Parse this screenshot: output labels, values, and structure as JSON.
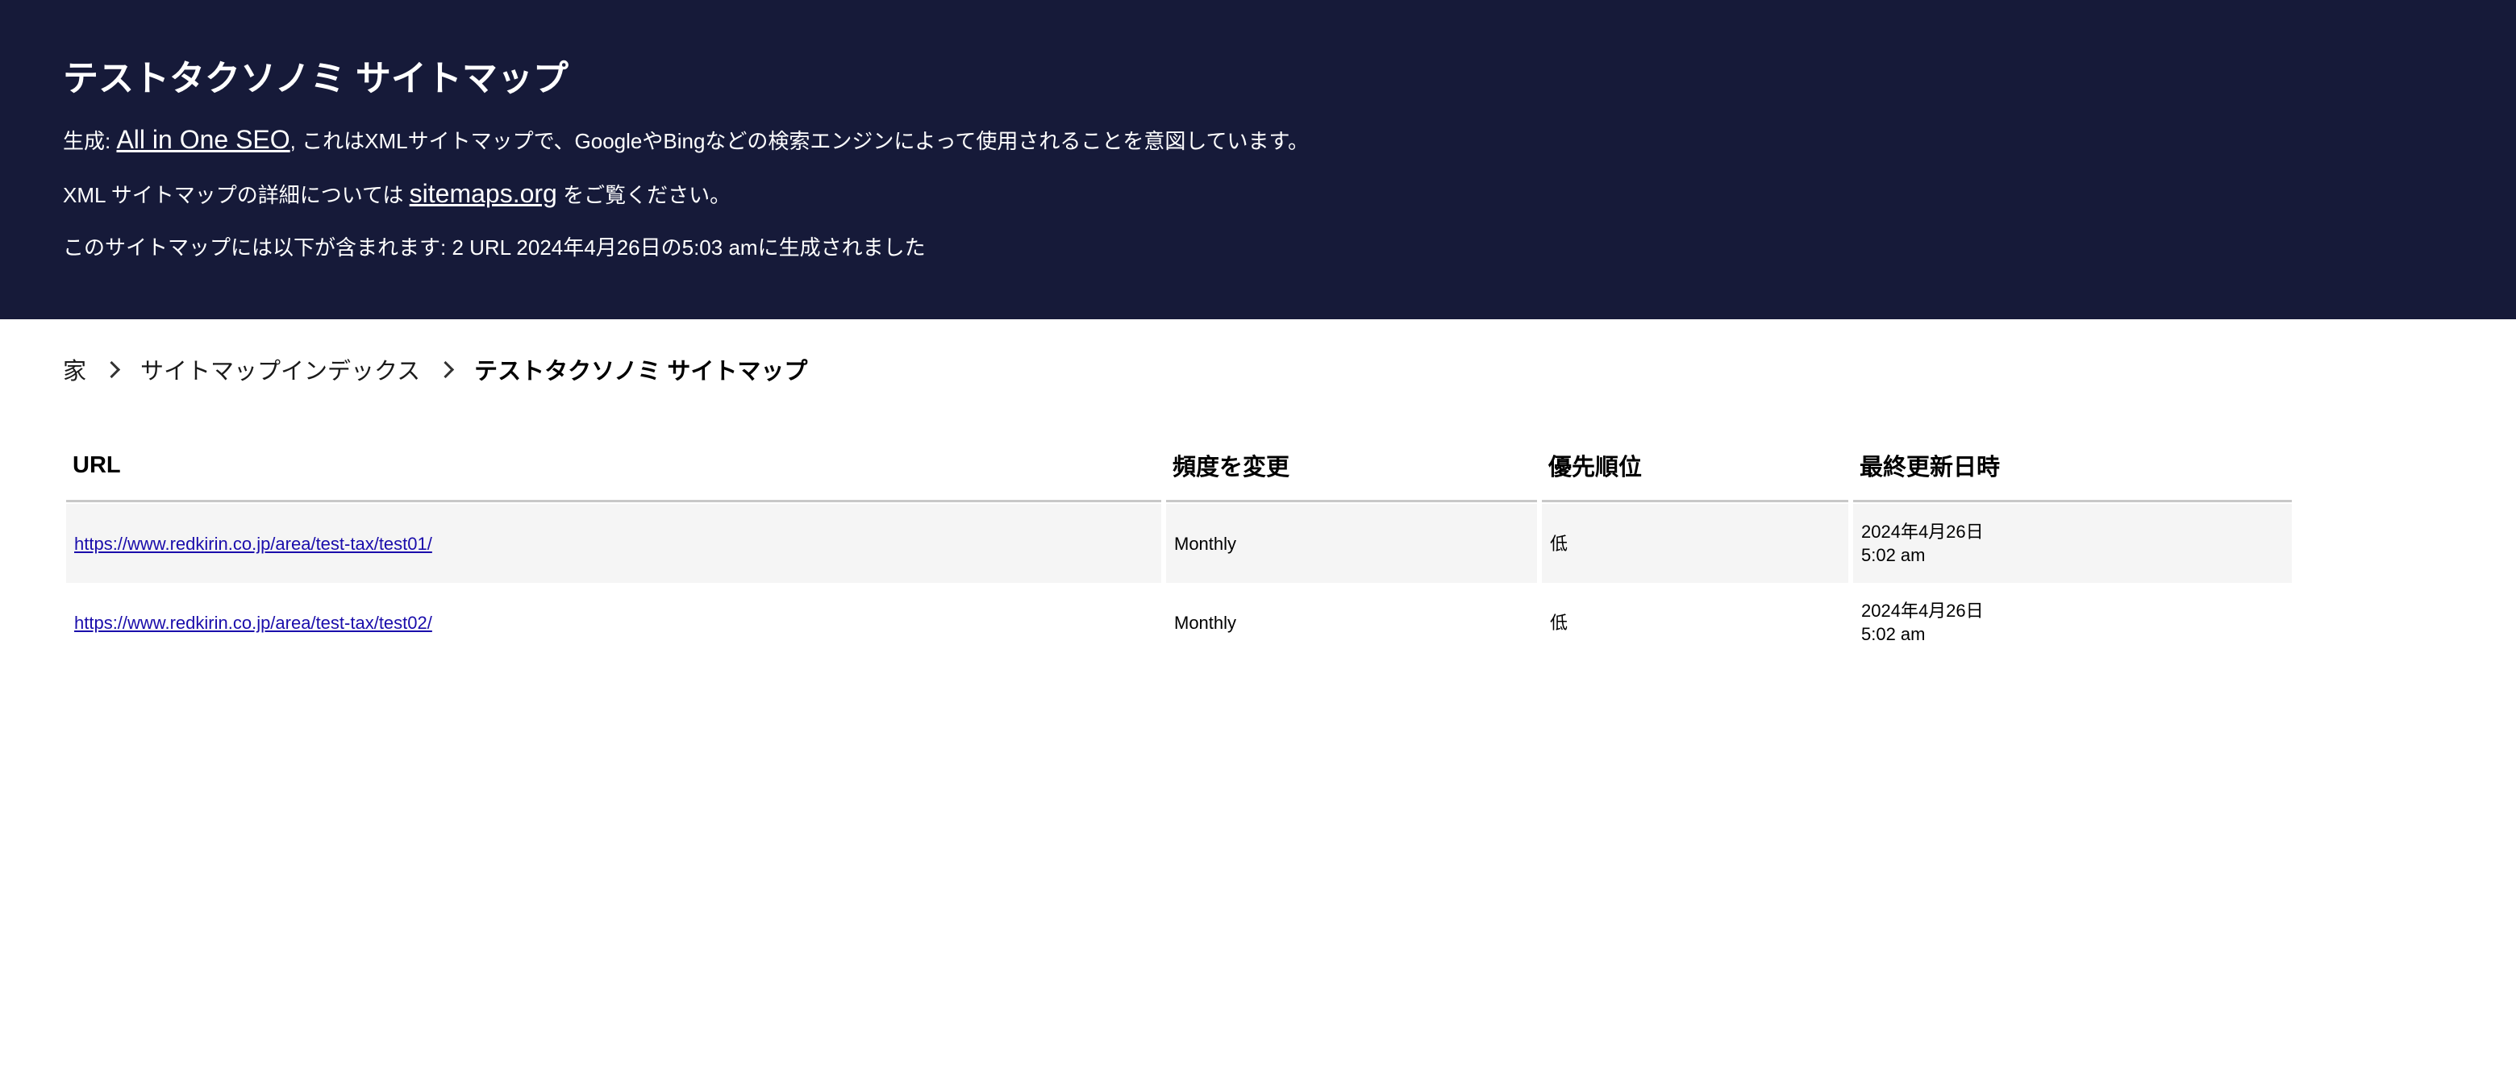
{
  "header": {
    "title": "テストタクソノミ サイトマップ",
    "line1_prefix": "生成: ",
    "line1_link": "All in One SEO",
    "line1_suffix": ", これはXMLサイトマップで、GoogleやBingなどの検索エンジンによって使用されることを意図しています。",
    "line2_prefix": "XML サイトマップの詳細については ",
    "line2_link": "sitemaps.org",
    "line2_suffix": " をご覧ください。",
    "line3": "このサイトマップには以下が含まれます: 2 URL 2024年4月26日の5:03 amに生成されました"
  },
  "breadcrumb": {
    "items": [
      "家",
      "サイトマップインデックス"
    ],
    "current": "テストタクソノミ サイトマップ"
  },
  "table": {
    "columns": [
      "URL",
      "頻度を変更",
      "優先順位",
      "最終更新日時"
    ],
    "rows": [
      {
        "url": "https://www.redkirin.co.jp/area/test-tax/test01/",
        "frequency": "Monthly",
        "priority": "低",
        "lastmod_date": "2024年4月26日",
        "lastmod_time": "5:02 am"
      },
      {
        "url": "https://www.redkirin.co.jp/area/test-tax/test02/",
        "frequency": "Monthly",
        "priority": "低",
        "lastmod_date": "2024年4月26日",
        "lastmod_time": "5:02 am"
      }
    ]
  },
  "colors": {
    "header_bg": "#161a39",
    "link": "#1a0dab",
    "row_alt": "#f5f5f5"
  }
}
